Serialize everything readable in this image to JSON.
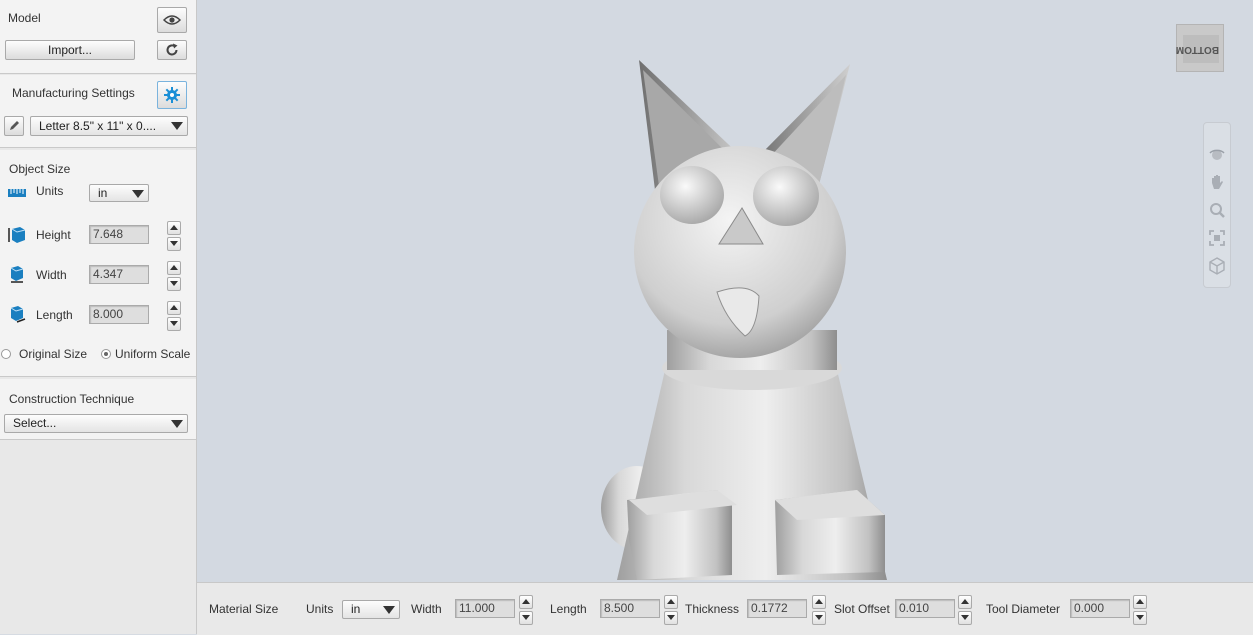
{
  "model": {
    "label": "Model",
    "import_label": "Import..."
  },
  "manufacturing": {
    "label": "Manufacturing Settings",
    "preset": "Letter 8.5\" x 11\" x 0...."
  },
  "object_size": {
    "label": "Object Size",
    "units_label": "Units",
    "units_value": "in",
    "height_label": "Height",
    "height_value": "7.648",
    "width_label": "Width",
    "width_value": "4.347",
    "length_label": "Length",
    "length_value": "8.000",
    "original_size_label": "Original Size",
    "uniform_scale_label": "Uniform Scale",
    "uniform_scale_selected": true
  },
  "construction": {
    "label": "Construction Technique",
    "select_value": "Select..."
  },
  "viewcube": {
    "face_label": "BOTTOM"
  },
  "material": {
    "label": "Material Size",
    "units_label": "Units",
    "units_value": "in",
    "width_label": "Width",
    "width_value": "11.000",
    "length_label": "Length",
    "length_value": "8.500",
    "thickness_label": "Thickness",
    "thickness_value": "0.1772",
    "slot_offset_label": "Slot Offset",
    "slot_offset_value": "0.010",
    "tool_diameter_label": "Tool Diameter",
    "tool_diameter_value": "0.000"
  },
  "colors": {
    "accent": "#1a8fd6",
    "viewport_bg": "#d3d9e1"
  },
  "icons": [
    "eye-icon",
    "refresh-icon",
    "gear-icon",
    "pencil-icon",
    "ruler-icon",
    "height-icon",
    "width-icon",
    "length-icon",
    "orbit-icon",
    "pan-icon",
    "zoom-icon",
    "fit-icon",
    "cube-icon"
  ]
}
